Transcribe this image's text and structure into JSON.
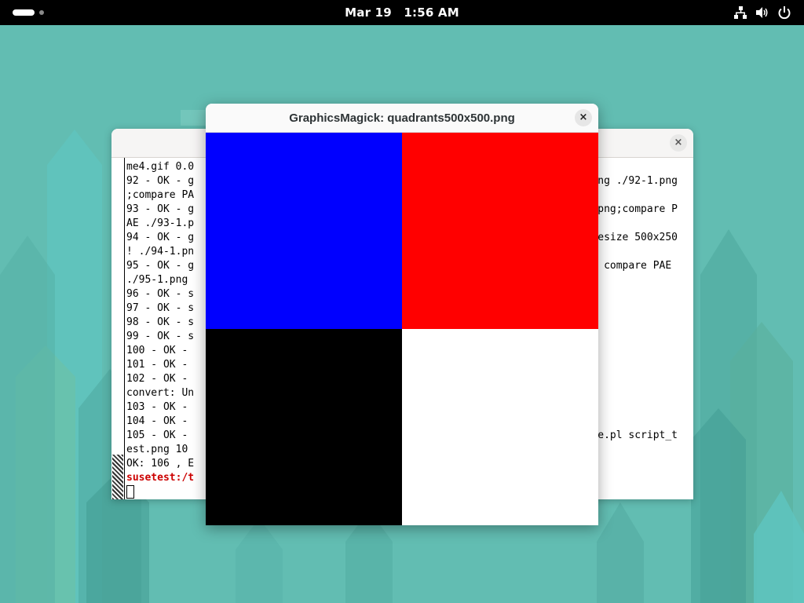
{
  "topbar": {
    "date": "Mar 19",
    "time": "1:56 AM",
    "icons": [
      "network-icon",
      "volume-icon",
      "power-icon"
    ]
  },
  "terminal": {
    "close_glyph": "×",
    "lines": [
      {
        "left": "me4.gif 0.0",
        "right": ""
      },
      {
        "left": "92 - OK - g",
        "right": "png ./92-1.png"
      },
      {
        "left": ";compare PA",
        "right": ""
      },
      {
        "left": "93 - OK - g",
        "right": "png;compare P"
      },
      {
        "left": "AE ./93-1.p",
        "right": ""
      },
      {
        "left": "94 - OK - g",
        "right": "esize 500x250"
      },
      {
        "left": "! ./94-1.pn",
        "right": ""
      },
      {
        "left": "95 - OK - g",
        "right": " compare PAE "
      },
      {
        "left": "./95-1.png ",
        "right": ""
      },
      {
        "left": "96 - OK - s",
        "right": ""
      },
      {
        "left": "97 - OK - s",
        "right": ""
      },
      {
        "left": "98 - OK - s",
        "right": ""
      },
      {
        "left": "99 - OK - s",
        "right": ""
      },
      {
        "left": "100 - OK - ",
        "right": ""
      },
      {
        "left": "101 - OK - ",
        "right": ""
      },
      {
        "left": "102 - OK - ",
        "right": ""
      },
      {
        "left": "convert: Un",
        "right": ""
      },
      {
        "left": "103 - OK - ",
        "right": ""
      },
      {
        "left": "104 - OK - ",
        "right": ""
      },
      {
        "left": "105 - OK - ",
        "right": "e.pl script_t"
      },
      {
        "left": "est.png 10 ",
        "right": ""
      },
      {
        "left": "OK: 106 , E",
        "right": ""
      }
    ],
    "prompt": "susetest:/t"
  },
  "viewer": {
    "title": "GraphicsMagick: quadrants500x500.png",
    "close_glyph": "×",
    "quadrants": {
      "top_left": "#0000ff",
      "top_right": "#ff0000",
      "bottom_left": "#000000",
      "bottom_right": "#ffffff"
    }
  }
}
